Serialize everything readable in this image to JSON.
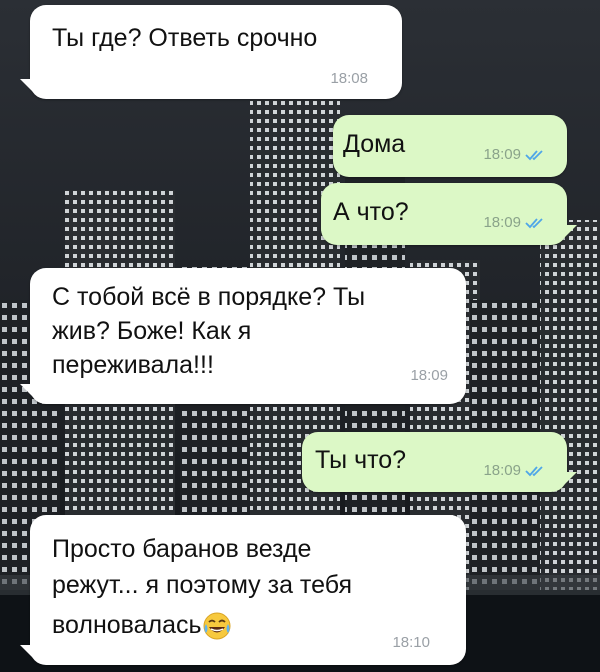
{
  "chat": {
    "messages": [
      {
        "direction": "in",
        "lines": [
          "Ты где? Ответь срочно"
        ],
        "time": "18:08"
      },
      {
        "direction": "out",
        "lines": [
          "Дома"
        ],
        "time": "18:09",
        "status": "read"
      },
      {
        "direction": "out",
        "lines": [
          "А что?"
        ],
        "time": "18:09",
        "status": "read"
      },
      {
        "direction": "in",
        "lines": [
          "С тобой всё в порядке?  Ты",
          "жив? Боже! Как я",
          "переживала!!!"
        ],
        "time": "18:09"
      },
      {
        "direction": "out",
        "lines": [
          "Ты что?"
        ],
        "time": "18:09",
        "status": "read"
      },
      {
        "direction": "in",
        "lines": [
          "Просто баранов везде",
          "режут... я поэтому за тебя",
          "волновалась"
        ],
        "time": "18:10",
        "emoji": "tears-of-joy"
      }
    ]
  },
  "colors": {
    "incoming_bubble": "#ffffff",
    "outgoing_bubble": "#dcf8c6",
    "read_ticks": "#4fa6e8"
  }
}
